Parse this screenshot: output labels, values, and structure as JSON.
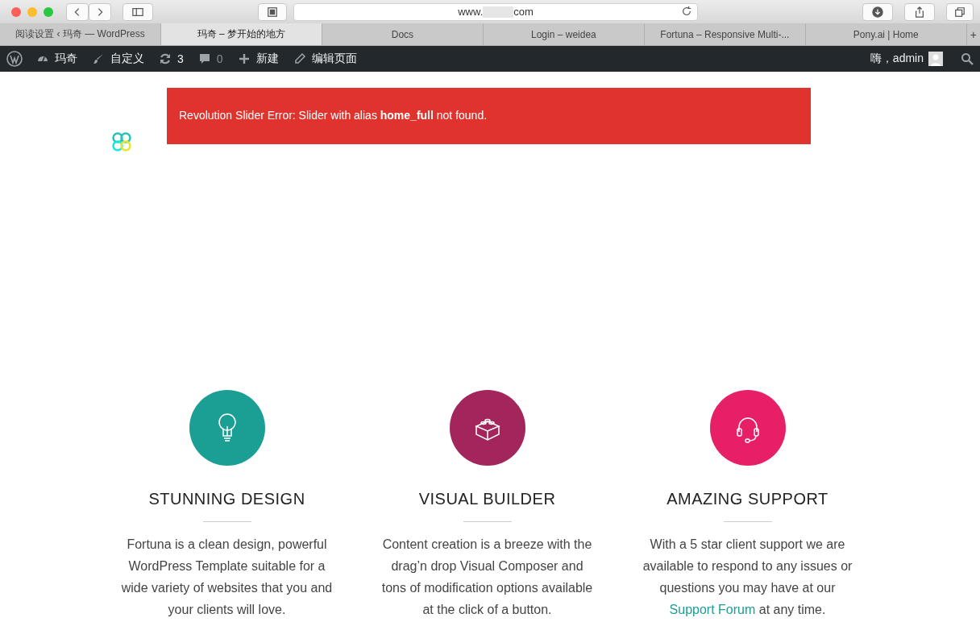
{
  "browser": {
    "url_start": "www.",
    "url_end": "com",
    "tabs": [
      {
        "label": "阅读设置 ‹ 玛奇 — WordPress",
        "selected": false
      },
      {
        "label": "玛奇 – 梦开始的地方",
        "selected": true
      },
      {
        "label": "Docs",
        "selected": false
      },
      {
        "label": "Login – weidea",
        "selected": false
      },
      {
        "label": "Fortuna – Responsive Multi-...",
        "selected": false
      },
      {
        "label": "Pony.ai | Home",
        "selected": false
      }
    ],
    "new_tab": "+"
  },
  "admin_bar": {
    "items": [
      {
        "kind": "site",
        "label": "玛奇"
      },
      {
        "kind": "customize",
        "label": "自定义"
      },
      {
        "kind": "updates",
        "label": "3"
      },
      {
        "kind": "comments",
        "label": "0"
      },
      {
        "kind": "new",
        "label": "新建"
      },
      {
        "kind": "edit",
        "label": "编辑页面"
      }
    ],
    "greeting": "嗨，admin"
  },
  "error": {
    "text": "Revolution Slider Error: Slider with alias **home_full** not found."
  },
  "features": [
    {
      "title": "STUNNING DESIGN",
      "color": "#1b9e94",
      "body": "Fortuna is a clean design, powerful WordPress Template suitable for a wide variety of websites that you and your clients will love."
    },
    {
      "title": "VISUAL BUILDER",
      "color": "#a2255b",
      "body": "Content creation is a breeze with the drag’n drop Visual Composer and tons of modification options available at the click of a button."
    },
    {
      "title": "AMAZING SUPPORT",
      "color": "#e61f66",
      "body": "With a 5 star client support we are available to respond to any issues or questions you may have at our",
      "link": "Support Forum",
      "after": " at any time."
    }
  ]
}
